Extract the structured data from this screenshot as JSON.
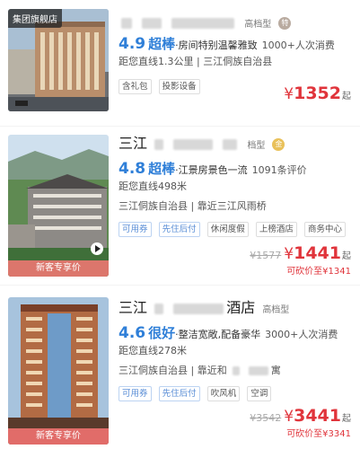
{
  "hotels": [
    {
      "thumb_tag": "集团旗舰店",
      "name_suffix": "高档型",
      "medal": "特",
      "score": "4.9",
      "grade": "超棒",
      "review": "·房间特别温馨雅致",
      "reviews_count": "1000+人次消费",
      "line1": "距您直线1.3公里 | 三江侗族自治县",
      "tags": [
        "含礼包",
        "投影设备"
      ],
      "price_symbol": "¥",
      "price": "1352",
      "price_suffix": "起"
    },
    {
      "name_prefix": "三江",
      "name_suffix": "档型",
      "medal": "金",
      "score": "4.8",
      "grade": "超棒",
      "review": "·江景房景色一流",
      "reviews_count": "1091条评价",
      "line1": "距您直线498米",
      "line2": "三江侗族自治县 | 靠近三江风雨桥",
      "tags": [
        "可用券",
        "先住后付",
        "休闲度假",
        "上榜酒店",
        "商务中心"
      ],
      "thumb_promo": "新客专享价",
      "old_price": "¥1577",
      "price_symbol": "¥",
      "price": "1441",
      "price_suffix": "起",
      "vip_price": "可砍价至¥1341"
    },
    {
      "name_prefix": "三江",
      "name_mid": "酒店",
      "name_suffix": "高档型",
      "score": "4.6",
      "grade": "很好",
      "review": "·整洁宽敞,配备豪华",
      "reviews_count": "3000+人次消费",
      "line1": "距您直线278米",
      "line2a": "三江侗族自治县 | 靠近和",
      "line2b": "寓",
      "tags": [
        "可用券",
        "先住后付",
        "吹风机",
        "空调"
      ],
      "thumb_promo": "新客专享价",
      "old_price": "¥3542",
      "price_symbol": "¥",
      "price": "3441",
      "price_suffix": "起",
      "vip_price": "可砍价至¥3341"
    }
  ],
  "colors": {
    "accent_blue": "#2f7fd8",
    "price_red": "#e0343b"
  }
}
